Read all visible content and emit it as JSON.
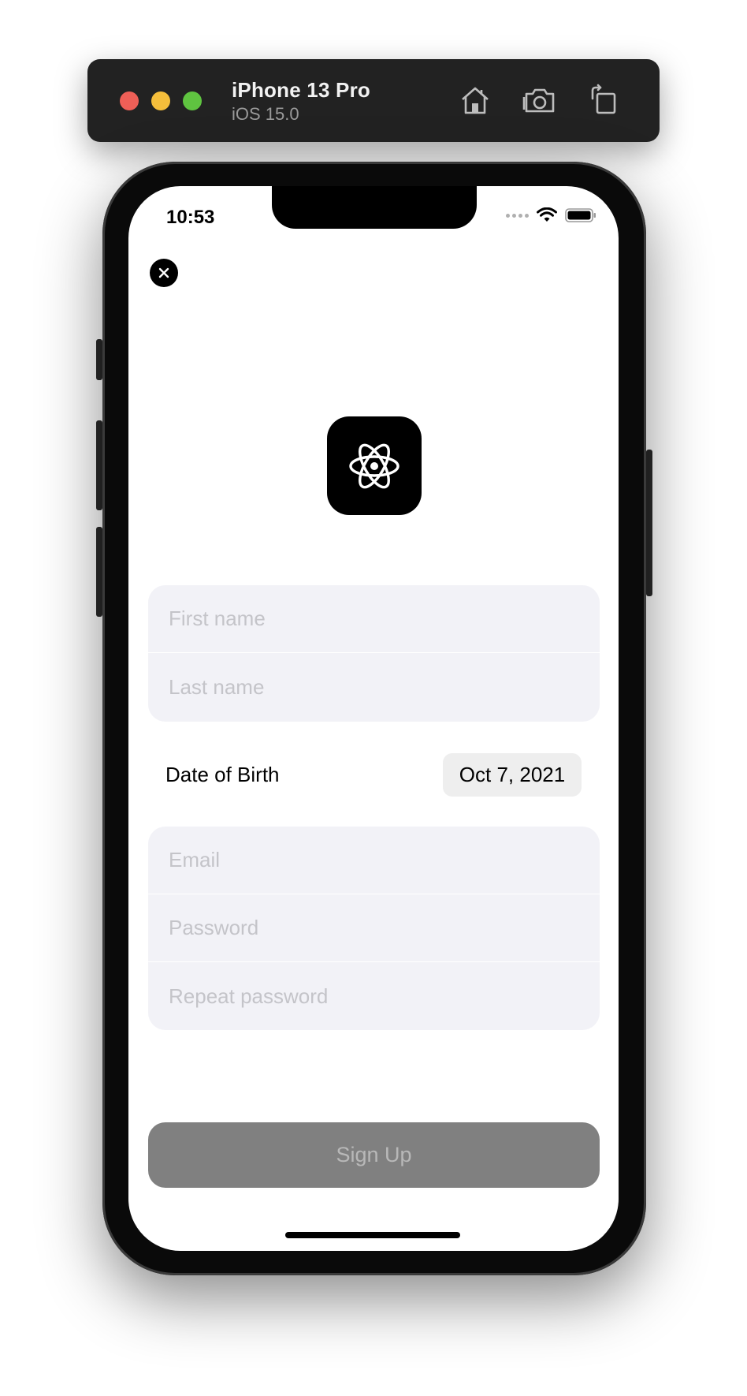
{
  "simulator": {
    "device_name": "iPhone 13 Pro",
    "os_version": "iOS 15.0",
    "toolbar_icons": [
      "home-icon",
      "screenshot-icon",
      "rotate-icon"
    ]
  },
  "status_bar": {
    "time": "10:53",
    "icons": [
      "signal-dots-icon",
      "wifi-icon",
      "battery-icon"
    ]
  },
  "form": {
    "first_name_placeholder": "First name",
    "last_name_placeholder": "Last name",
    "dob_label": "Date of Birth",
    "dob_value": "Oct 7, 2021",
    "email_placeholder": "Email",
    "password_placeholder": "Password",
    "repeat_password_placeholder": "Repeat password",
    "submit_label": "Sign Up"
  },
  "colors": {
    "field_background": "#f2f2f7",
    "placeholder_text": "#c4c4c9",
    "button_disabled": "#808080",
    "button_text": "#b8b8b8"
  }
}
